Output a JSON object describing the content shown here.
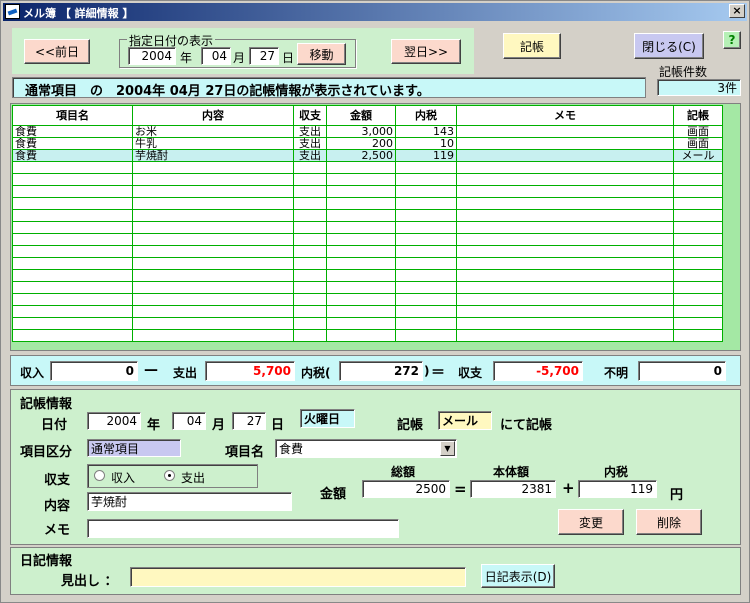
{
  "window": {
    "title": "メル簿 【 詳細情報 】",
    "close": "×"
  },
  "nav": {
    "prev_label": "<<前日",
    "next_label": "翌日>>",
    "group_label": "指定日付の表示",
    "year": "2004",
    "year_unit": "年",
    "month": "04",
    "month_unit": "月",
    "day": "27",
    "day_unit": "日",
    "move_label": "移動",
    "book_label": "記帳",
    "close_label": "閉じる(C)",
    "help_label": "?"
  },
  "banner": {
    "text": "通常項目　の　2004年 04月 27日の記帳情報が表示されています。"
  },
  "count": {
    "label": "記帳件数",
    "value": "3件"
  },
  "table": {
    "headers": [
      "項目名",
      "内容",
      "収支",
      "金額",
      "内税",
      "メモ",
      "記帳"
    ],
    "rows": [
      [
        "食費",
        "お米",
        "支出",
        "3,000",
        "143",
        "",
        "画面"
      ],
      [
        "食費",
        "牛乳",
        "支出",
        "200",
        "10",
        "",
        "画面"
      ],
      [
        "食費",
        "芋焼酎",
        "支出",
        "2,500",
        "119",
        "",
        "メール"
      ]
    ],
    "selected_row": 2,
    "empty_rows": 15
  },
  "summary": {
    "income_label": "収入",
    "income": "0",
    "dash": "—",
    "expense_label": "支出",
    "expense": "5,700",
    "tax_label": "内税(",
    "tax": "272",
    "tax_close": ")",
    "eq": "＝",
    "balance_label": "収支",
    "balance": "-5,700",
    "unknown_label": "不明",
    "unknown": "0"
  },
  "detail": {
    "section": "記帳情報",
    "date_label": "日付",
    "year": "2004",
    "year_unit": "年",
    "month": "04",
    "month_unit": "月",
    "day": "27",
    "day_unit": "日",
    "weekday": "火曜日",
    "book_label": "記帳",
    "book_value": "メール",
    "book_suffix": "にて記帳",
    "category_label": "項目区分",
    "category_value": "通常項目",
    "item_label": "項目名",
    "item_value": "食費",
    "balance_label": "収支",
    "income_option": "収入",
    "expense_option": "支出",
    "content_label": "内容",
    "content_value": "芋焼酎",
    "memo_label": "メモ",
    "memo_value": "",
    "amount_label": "金額",
    "total_label": "総額",
    "total_value": "2500",
    "eq": "=",
    "base_label": "本体額",
    "base_value": "2381",
    "plus": "+",
    "tax_label": "内税",
    "tax_value": "119",
    "yen": "円",
    "change_label": "変更",
    "delete_label": "削除"
  },
  "diary": {
    "section": "日記情報",
    "heading_label": "見出し ：",
    "heading_value": "",
    "show_label": "日記表示(D)"
  }
}
